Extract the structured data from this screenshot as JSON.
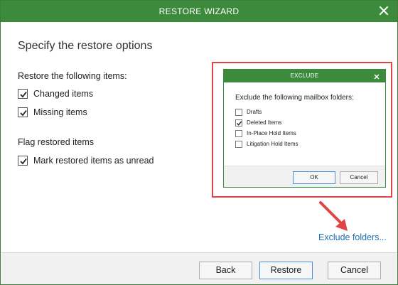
{
  "window": {
    "title": "RESTORE WIZARD"
  },
  "page": {
    "heading": "Specify the restore options"
  },
  "restore_items": {
    "label": "Restore the following items:",
    "options": [
      {
        "label": "Changed items",
        "checked": true
      },
      {
        "label": "Missing items",
        "checked": true
      }
    ]
  },
  "flag_items": {
    "label": "Flag restored items",
    "options": [
      {
        "label": "Mark restored items as unread",
        "checked": true
      }
    ]
  },
  "exclude_link": "Exclude folders...",
  "footer": {
    "back_label": "Back",
    "restore_label": "Restore",
    "cancel_label": "Cancel"
  },
  "exclude_dialog": {
    "title": "EXCLUDE",
    "heading": "Exclude the following mailbox folders:",
    "folders": [
      {
        "label": "Drafts",
        "checked": false
      },
      {
        "label": "Deleted Items",
        "checked": true
      },
      {
        "label": "In-Place Hold Items",
        "checked": false
      },
      {
        "label": "Litigation Hold Items",
        "checked": false
      }
    ],
    "ok_label": "OK",
    "cancel_label": "Cancel"
  },
  "colors": {
    "titlebar": "#3c8a3c",
    "link": "#1b6fb5",
    "highlight": "#e04444",
    "primary_border": "#4a90d9"
  }
}
